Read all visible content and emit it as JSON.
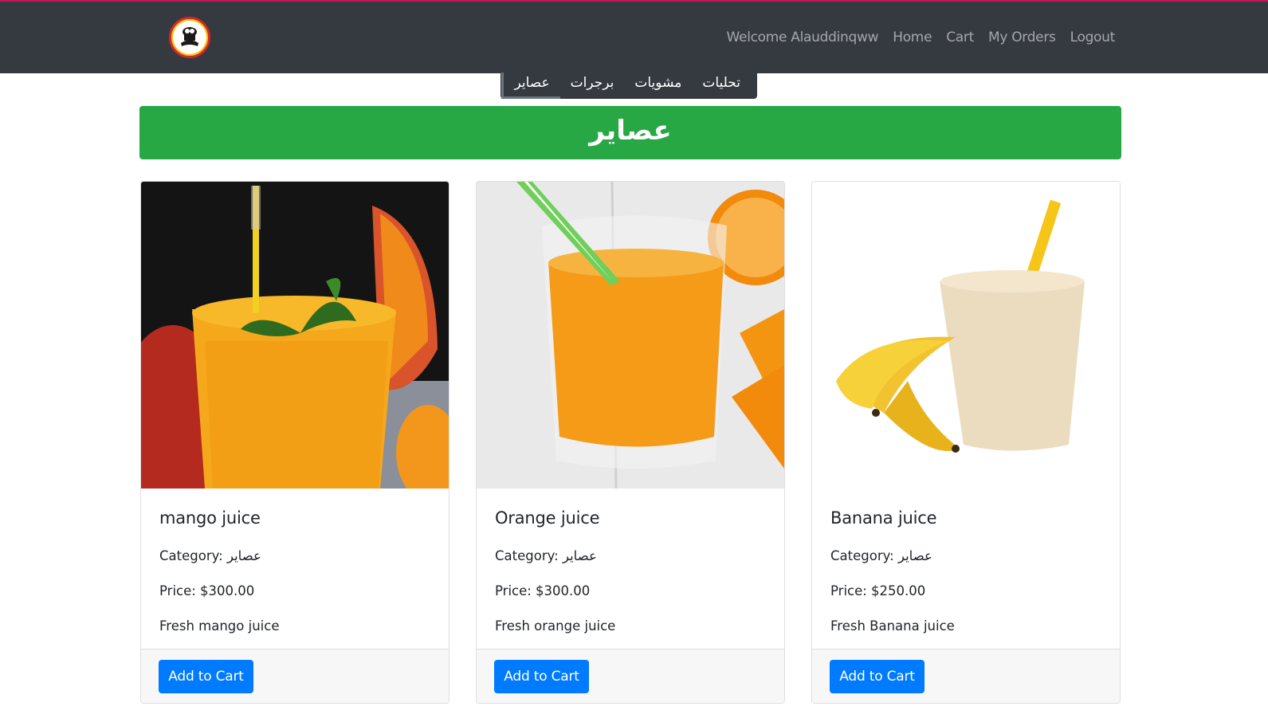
{
  "navbar": {
    "welcome": "Welcome Alauddinqww",
    "links": [
      "Home",
      "Cart",
      "My Orders",
      "Logout"
    ]
  },
  "categories": {
    "tabs": [
      "تحليات",
      "مشويات",
      "برجرات",
      "عصاير"
    ],
    "active": "عصاير"
  },
  "banner": {
    "title": "عصاير"
  },
  "products": [
    {
      "name": "mango juice",
      "category": "Category: عصاير",
      "price": "Price: $300.00",
      "description": "Fresh mango juice",
      "button": "Add to Cart"
    },
    {
      "name": "Orange juice",
      "category": "Category: عصاير",
      "price": "Price: $300.00",
      "description": "Fresh orange juice",
      "button": "Add to Cart"
    },
    {
      "name": "Banana juice",
      "category": "Category: عصاير",
      "price": "Price: $250.00",
      "description": "Fresh Banana juice",
      "button": "Add to Cart"
    }
  ],
  "colors": {
    "navbar": "#343a40",
    "banner": "#28a745",
    "button": "#007bff"
  }
}
